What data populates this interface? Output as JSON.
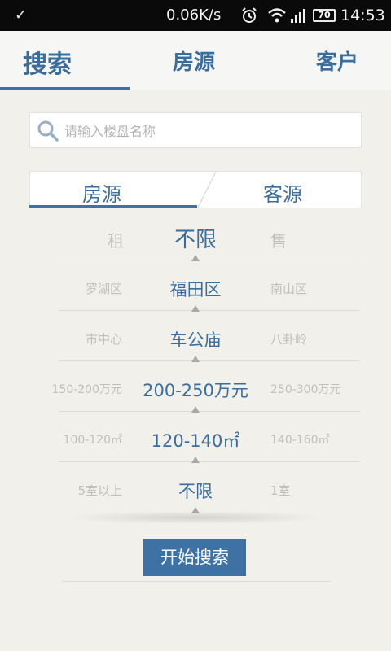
{
  "status_bar": {
    "speed": "0.06K/s",
    "battery": "70",
    "time": "14:53"
  },
  "top_tabs": {
    "search": "搜索",
    "house": "房源",
    "client": "客户"
  },
  "search": {
    "placeholder": "请输入楼盘名称"
  },
  "segment": {
    "left": "房源",
    "right": "客源"
  },
  "picker_rows": [
    {
      "left": "租",
      "center": "不限",
      "right": "售"
    },
    {
      "left": "罗湖区",
      "center": "福田区",
      "right": "南山区"
    },
    {
      "left": "市中心",
      "center": "车公庙",
      "right": "八卦岭"
    },
    {
      "left": "150-200万元",
      "center": "200-250万元",
      "right": "250-300万元"
    },
    {
      "left": "100-120㎡",
      "center": "120-140㎡",
      "right": "140-160㎡"
    },
    {
      "left": "5室以上",
      "center": "不限",
      "right": "1室"
    }
  ],
  "actions": {
    "start_search": "开始搜索"
  },
  "colors": {
    "accent": "#3f72a4",
    "background": "#f1f0ea"
  }
}
